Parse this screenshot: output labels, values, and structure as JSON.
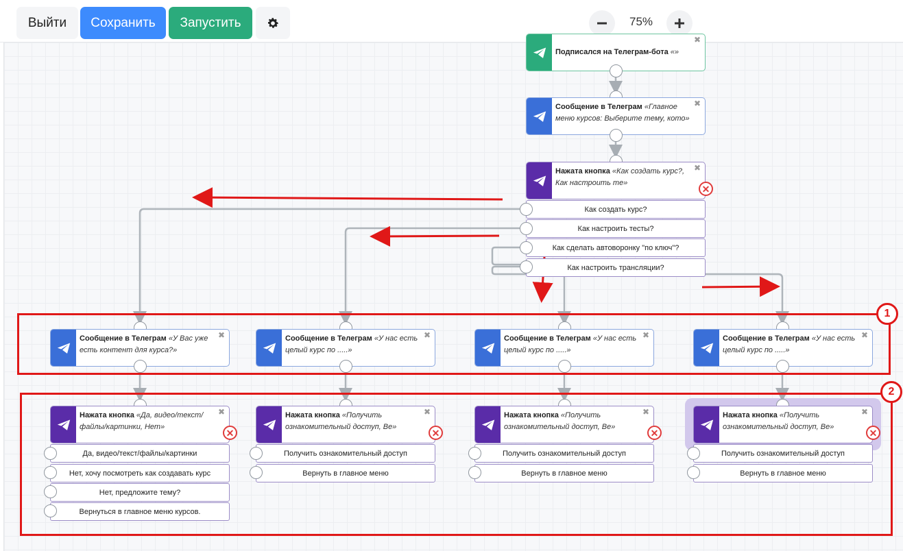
{
  "toolbar": {
    "exit_label": "Выйти",
    "save_label": "Сохранить",
    "run_label": "Запустить",
    "zoom_value": "75%",
    "zoom_out_icon": "minus-icon",
    "zoom_in_icon": "plus-icon",
    "settings_icon": "gear-icon"
  },
  "colors": {
    "save": "#3d8bfd",
    "run": "#2bab7c",
    "trigger": "#2bab7c",
    "message": "#3a6fd8",
    "button_press": "#5a2ca8",
    "annotation": "#e01818"
  },
  "flow": {
    "trigger": {
      "title": "Подписался на Телеграм-бота",
      "detail": "«»",
      "icon": "telegram-icon"
    },
    "main_menu": {
      "title": "Сообщение в Телеграм",
      "detail": "«Главное меню курсов: Выберите тему, кото»",
      "icon": "telegram-icon"
    },
    "menu_buttons": {
      "title": "Нажата кнопка",
      "detail": "«Как создать курс?, Как настроить те»",
      "options": [
        "Как создать курс?",
        "Как настроить тесты?",
        "Как сделать автоворонку \"по ключ\"?",
        "Как настроить трансляции?"
      ]
    },
    "messages": [
      {
        "title": "Сообщение в Телеграм",
        "detail": "«У Вас уже есть контент для курса?»"
      },
      {
        "title": "Сообщение в Телеграм",
        "detail": "«У нас есть целый курс по .....»"
      },
      {
        "title": "Сообщение в Телеграм",
        "detail": "«У нас есть целый курс по .....»"
      },
      {
        "title": "Сообщение в Телеграм",
        "detail": "«У нас есть целый курс по .....»"
      }
    ],
    "button_nodes": [
      {
        "title": "Нажата кнопка",
        "detail": "«Да, видео/текст/файлы/картинки, Нет»",
        "options": [
          "Да, видео/текст/файлы/картинки",
          "Нет, хочу посмотреть как создавать курс",
          "Нет, предложите тему?",
          "Вернуться в главное меню курсов."
        ]
      },
      {
        "title": "Нажата кнопка",
        "detail": "«Получить ознакомительный доступ, Ве»",
        "options": [
          "Получить ознакомительный доступ",
          "Вернуть в главное меню"
        ]
      },
      {
        "title": "Нажата кнопка",
        "detail": "«Получить ознакомительный доступ, Ве»",
        "options": [
          "Получить ознакомительный доступ",
          "Вернуть в главное меню"
        ]
      },
      {
        "title": "Нажата кнопка",
        "detail": "«Получить ознакомительный доступ, Ве»",
        "options": [
          "Получить ознакомительный доступ",
          "Вернуть в главное меню"
        ]
      }
    ]
  },
  "annotations": {
    "badge_1": "1",
    "badge_2": "2"
  }
}
